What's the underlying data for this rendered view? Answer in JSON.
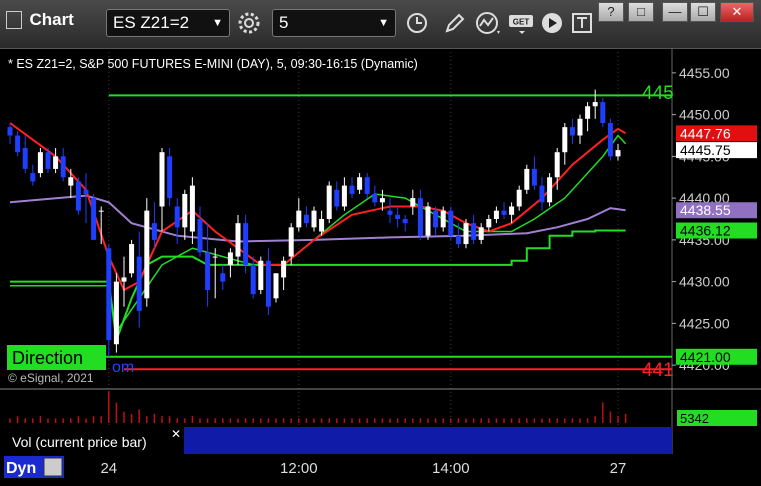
{
  "app": {
    "title": "Chart",
    "symbol": "ES Z21=2",
    "interval": "5",
    "window_buttons": [
      "?",
      "□",
      "—",
      "☐",
      "✕"
    ]
  },
  "header": {
    "description": "* ES Z21=2, S&P 500 FUTURES E-MINI (DAY), 5, 09:30-16:15 (Dynamic)",
    "copyright": "© eSignal, 2021"
  },
  "overlays": {
    "direction_label": "Direction",
    "upper_level_text": "445",
    "lower_level_text": "441",
    "partial_text": "om"
  },
  "volume_panel": {
    "label": "Vol (current price bar)",
    "value_tag": "5342",
    "close_symbol": "✕"
  },
  "statusbar": {
    "dyn_label": "Dyn"
  },
  "colors": {
    "up": "#ffffff",
    "down": "#1f3fff",
    "ma_red": "#ff2020",
    "ma_green": "#22dd22",
    "ma_purple": "#a080d0",
    "level_line": "#22dd22",
    "red_line": "#ff2020"
  },
  "chart_data": {
    "type": "candlestick",
    "y_ticks": [
      4420,
      4425,
      4430,
      4435,
      4440,
      4445,
      4450,
      4455
    ],
    "y_tick_labels": [
      "4420.00",
      "4425.00",
      "4430.00",
      "4435.00",
      "4440.00",
      "4445.00",
      "4450.00",
      "4455.00"
    ],
    "ylim": [
      4417.5,
      4457.5
    ],
    "x_ticks": [
      {
        "index": 13,
        "label": "24"
      },
      {
        "index": 38,
        "label": "12:00"
      },
      {
        "index": 58,
        "label": "14:00"
      },
      {
        "index": 80,
        "label": "27"
      }
    ],
    "candles": [
      [
        4448.5,
        4449,
        4446.5,
        4447.5
      ],
      [
        4447.5,
        4448,
        4445,
        4445.5
      ],
      [
        4446,
        4447.5,
        4443,
        4443.5
      ],
      [
        4443,
        4444,
        4441.5,
        4442
      ],
      [
        4443,
        4446,
        4442.5,
        4445.5
      ],
      [
        4445.5,
        4446,
        4443,
        4443.5
      ],
      [
        4443.5,
        4446,
        4443,
        4445
      ],
      [
        4445,
        4446,
        4442,
        4442.5
      ],
      [
        4441.5,
        4443.5,
        4440,
        4442.5
      ],
      [
        4442,
        4442.5,
        4438,
        4438.5
      ],
      [
        4441,
        4443,
        4437,
        4440.5
      ],
      [
        4440,
        4440.5,
        4435,
        4435
      ],
      [
        4438.5,
        4439,
        4434.5,
        4438.5
      ],
      [
        4434,
        4434.5,
        4421,
        4423
      ],
      [
        4422.5,
        4431,
        4421.5,
        4430
      ],
      [
        4430,
        4433,
        4427,
        4430.5
      ],
      [
        4431,
        4435,
        4430.5,
        4434.5
      ],
      [
        4433,
        4436,
        4424.5,
        4426.5
      ],
      [
        4428,
        4440,
        4427,
        4438.5
      ],
      [
        4437,
        4439.5,
        4434,
        4435
      ],
      [
        4439,
        4446,
        4436,
        4445.5
      ],
      [
        4445,
        4446,
        4439,
        4440
      ],
      [
        4439,
        4440,
        4434.5,
        4436.5
      ],
      [
        4436.5,
        4441,
        4435,
        4440.5
      ],
      [
        4436,
        4442.5,
        4434.5,
        4441.5
      ],
      [
        4437.5,
        4439,
        4433,
        4433.5
      ],
      [
        4433.5,
        4437,
        4427,
        4429
      ],
      [
        4433,
        4434,
        4428,
        4433
      ],
      [
        4431,
        4432,
        4429,
        4430
      ],
      [
        4432,
        4434,
        4430.5,
        4433.5
      ],
      [
        4433,
        4438,
        4432,
        4437
      ],
      [
        4437,
        4438,
        4431,
        4432
      ],
      [
        4432,
        4433,
        4428,
        4428.5
      ],
      [
        4429,
        4433,
        4428.5,
        4432.5
      ],
      [
        4432.5,
        4434,
        4426,
        4427
      ],
      [
        4428,
        4431,
        4427.5,
        4431
      ],
      [
        4430.5,
        4433,
        4429,
        4432.5
      ],
      [
        4433,
        4437,
        4432,
        4436.5
      ],
      [
        4436.5,
        4440,
        4436,
        4438.5
      ],
      [
        4438,
        4439,
        4436.5,
        4437
      ],
      [
        4436.5,
        4439,
        4436,
        4438.5
      ],
      [
        4436,
        4438.5,
        4435.5,
        4437.5
      ],
      [
        4437.5,
        4442,
        4437,
        4441.5
      ],
      [
        4441,
        4442,
        4438.5,
        4439
      ],
      [
        4439,
        4442.5,
        4438.5,
        4441.5
      ],
      [
        4441.5,
        4442.5,
        4440,
        4440.5
      ],
      [
        4441,
        4443,
        4440.5,
        4442.5
      ],
      [
        4442.5,
        4443,
        4440,
        4440.5
      ],
      [
        4440.5,
        4441.5,
        4439,
        4439.5
      ],
      [
        4439.5,
        4441,
        4438.5,
        4440
      ],
      [
        4438.5,
        4440,
        4437,
        4438
      ],
      [
        4438,
        4439,
        4436.5,
        4437.5
      ],
      [
        4437.5,
        4438,
        4436,
        4437
      ],
      [
        4439,
        4441,
        4438,
        4440
      ],
      [
        4440,
        4441,
        4435,
        4435.5
      ],
      [
        4435.5,
        4439.5,
        4435,
        4439
      ],
      [
        4438.5,
        4439,
        4435.5,
        4436.5
      ],
      [
        4436.5,
        4439,
        4436,
        4438.5
      ],
      [
        4438.5,
        4439,
        4435,
        4435.5
      ],
      [
        4435.5,
        4437,
        4434,
        4434.5
      ],
      [
        4434.5,
        4437.5,
        4434,
        4437
      ],
      [
        4437,
        4438,
        4434.5,
        4435
      ],
      [
        4435,
        4437,
        4434.5,
        4436.5
      ],
      [
        4436.5,
        4438,
        4436,
        4437.5
      ],
      [
        4437.5,
        4439,
        4437,
        4438.5
      ],
      [
        4438.5,
        4439.5,
        4437.5,
        4438
      ],
      [
        4438,
        4439.5,
        4437,
        4439
      ],
      [
        4439,
        4441.5,
        4438.5,
        4441
      ],
      [
        4441,
        4444,
        4440.5,
        4443.5
      ],
      [
        4443.5,
        4445,
        4441,
        4441.5
      ],
      [
        4441.5,
        4442.5,
        4438.5,
        4439.5
      ],
      [
        4439.5,
        4443,
        4439,
        4442.5
      ],
      [
        4442.5,
        4446,
        4441,
        4445.5
      ],
      [
        4445.5,
        4449,
        4444,
        4448.5
      ],
      [
        4448.5,
        4449.5,
        4446.5,
        4447.5
      ],
      [
        4447.5,
        4450,
        4446.5,
        4449.5
      ],
      [
        4449.5,
        4451.5,
        4448,
        4451
      ],
      [
        4451,
        4453,
        4449.5,
        4451.5
      ],
      [
        4451.5,
        4452,
        4448.5,
        4449
      ],
      [
        4449,
        4449.5,
        4444.5,
        4445
      ],
      [
        4445,
        4446.5,
        4444.5,
        4445.75
      ]
    ],
    "ma_red": [
      [
        0,
        4449
      ],
      [
        3,
        4447
      ],
      [
        6,
        4445
      ],
      [
        10,
        4441
      ],
      [
        13,
        4433
      ],
      [
        15,
        4429
      ],
      [
        17,
        4430
      ],
      [
        20,
        4436
      ],
      [
        24,
        4438.5
      ],
      [
        27,
        4436
      ],
      [
        30,
        4434
      ],
      [
        33,
        4432
      ],
      [
        36,
        4432
      ],
      [
        40,
        4435
      ],
      [
        45,
        4438
      ],
      [
        50,
        4439
      ],
      [
        54,
        4439
      ],
      [
        57,
        4438.5
      ],
      [
        60,
        4437
      ],
      [
        63,
        4436
      ],
      [
        66,
        4437
      ],
      [
        70,
        4440
      ],
      [
        74,
        4444
      ],
      [
        78,
        4447
      ],
      [
        80,
        4448.3
      ],
      [
        81,
        4447.76
      ]
    ],
    "ma_green": [
      [
        0,
        4429.5
      ],
      [
        13,
        4429.5
      ],
      [
        14,
        4424
      ],
      [
        17,
        4428
      ],
      [
        20,
        4432
      ],
      [
        24,
        4434
      ],
      [
        28,
        4433
      ],
      [
        32,
        4432
      ],
      [
        36,
        4432
      ],
      [
        40,
        4435
      ],
      [
        44,
        4438
      ],
      [
        48,
        4440.5
      ],
      [
        52,
        4440
      ],
      [
        56,
        4438
      ],
      [
        60,
        4436
      ],
      [
        64,
        4436
      ],
      [
        66,
        4436
      ],
      [
        69,
        4437.5
      ],
      [
        73,
        4440
      ],
      [
        76,
        4443
      ],
      [
        78,
        4445
      ],
      [
        80,
        4447.5
      ],
      [
        81,
        4446.5
      ]
    ],
    "ma_purple": [
      [
        0,
        4439.5
      ],
      [
        10,
        4440.3
      ],
      [
        13,
        4439.5
      ],
      [
        16,
        4437
      ],
      [
        22,
        4435.5
      ],
      [
        30,
        4434.8
      ],
      [
        40,
        4435
      ],
      [
        50,
        4435.3
      ],
      [
        60,
        4435.5
      ],
      [
        68,
        4435.8
      ],
      [
        72,
        4436.5
      ],
      [
        76,
        4437.5
      ],
      [
        79,
        4438.8
      ],
      [
        81,
        4438.55
      ]
    ],
    "support_step": [
      [
        0,
        4430
      ],
      [
        13,
        4430
      ],
      [
        14,
        4423
      ],
      [
        16,
        4428
      ],
      [
        18,
        4432
      ],
      [
        20,
        4433
      ],
      [
        24,
        4433
      ],
      [
        26,
        4432
      ],
      [
        33,
        4432
      ],
      [
        33,
        4432
      ],
      [
        66,
        4432
      ],
      [
        66,
        4432.5
      ],
      [
        68,
        4432.5
      ],
      [
        68,
        4434
      ],
      [
        71,
        4434
      ],
      [
        71,
        4435.5
      ],
      [
        74,
        4435.5
      ],
      [
        74,
        4436
      ],
      [
        77,
        4436
      ],
      [
        77,
        4436.12
      ],
      [
        81,
        4436.12
      ]
    ],
    "levels": [
      {
        "value": 4452.3,
        "color": "#22dd22",
        "from": 13
      },
      {
        "value": 4421.0,
        "color": "#22dd22",
        "from": 0
      },
      {
        "value": 4419.5,
        "color": "#ff2020",
        "from": 15
      }
    ],
    "price_tags": [
      {
        "value": 4447.76,
        "text": "4447.76",
        "bg": "#e01010",
        "fg": "#ffffff"
      },
      {
        "value": 4445.75,
        "text": "4445.75",
        "bg": "#ffffff",
        "fg": "#000000"
      },
      {
        "value": 4438.55,
        "text": "4438.55",
        "bg": "#9070c0",
        "fg": "#ffffff"
      },
      {
        "value": 4436.12,
        "text": "4436.12",
        "bg": "#22dd22",
        "fg": "#000000"
      },
      {
        "value": 4421.0,
        "text": "4421.00",
        "bg": "#22dd22",
        "fg": "#000000"
      }
    ],
    "volume": [
      2,
      3,
      2,
      2,
      3,
      2,
      2,
      2,
      2,
      3,
      2,
      3,
      3,
      14,
      9,
      5,
      4,
      6,
      3,
      4,
      3,
      3,
      2,
      2,
      3,
      2,
      2,
      2,
      2,
      2,
      2,
      2,
      2,
      2,
      2,
      2,
      2,
      2,
      2,
      2,
      2,
      2,
      2,
      2,
      2,
      2,
      2,
      2,
      2,
      2,
      2,
      2,
      2,
      2,
      2,
      2,
      2,
      2,
      2,
      2,
      2,
      2,
      2,
      2,
      2,
      2,
      2,
      2,
      2,
      2,
      2,
      2,
      2,
      2,
      2,
      2,
      2,
      3,
      9,
      5,
      3,
      4
    ],
    "volume_max": 14
  }
}
